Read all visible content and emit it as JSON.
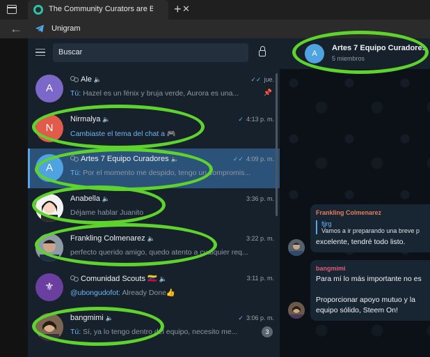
{
  "browser": {
    "tab_title": "The Community Curators are Bac",
    "tab_close": "✕",
    "new_tab": "+",
    "back": "←",
    "app_name": "Unigram"
  },
  "sidebar": {
    "search_placeholder": "Buscar"
  },
  "chats": [
    {
      "avatar_letter": "A",
      "avatar_color": "#7b68c9",
      "group": true,
      "name": "Ale",
      "muted": true,
      "time": "jue.",
      "ticks": "✓✓",
      "sender": "Tú:",
      "preview": "Hazel es un fénix y bruja verde, Aurora es una...",
      "pinned": true
    },
    {
      "avatar_letter": "N",
      "avatar_color": "#e25b4a",
      "group": false,
      "name": "Nirmalya",
      "muted": true,
      "time": "4:13 p. m.",
      "ticks": "✓",
      "preview_link": "Cambiaste el tema del chat a 🎮"
    },
    {
      "avatar_letter": "A",
      "avatar_color": "#4fa3e0",
      "group": true,
      "name": "Artes 7 Equipo Curadores",
      "muted": true,
      "time": "4:09 p. m.",
      "ticks": "✓✓",
      "sender": "Tú:",
      "preview": "Por el momento me despido, tengo un compromis...",
      "selected": true
    },
    {
      "avatar_letter": "",
      "avatar_color": "#e8e8e8",
      "group": false,
      "name": "Anabella",
      "muted": true,
      "time": "3:36 p. m.",
      "preview": "Déjame hablar Juanito"
    },
    {
      "avatar_letter": "",
      "avatar_color": "#9aa7b5",
      "group": false,
      "name": "Frankling Colmenarez",
      "muted": true,
      "time": "3:22 p. m.",
      "preview": "perfecto querido amigo, quedo atento a cualquier req..."
    },
    {
      "avatar_letter": "⚜",
      "avatar_color": "#6b3fa0",
      "group": true,
      "name": "Comunidad Scouts 🇻🇪",
      "muted": true,
      "time": "3:11 p. m.",
      "mention": "@ubongudofot:",
      "preview": "Already  Done👍"
    },
    {
      "avatar_letter": "",
      "avatar_color": "#8a6a4a",
      "group": false,
      "name": "bangmimi",
      "muted": true,
      "time": "3:06 p. m.",
      "ticks": "✓",
      "sender": "Tú:",
      "preview": "Sí, ya lo tengo dentro del equipo, necesito me...",
      "unread": "3"
    }
  ],
  "conversation": {
    "avatar_letter": "A",
    "title": "Artes 7 Equipo Curadores",
    "subtitle": "5 miembros",
    "messages": [
      {
        "sender": "Frankling Colmenarez",
        "sender_color": "#e87c5b",
        "reply_name": "fjjrg",
        "reply_text": "Vamos a ir preparando una breve p",
        "text": "excelente, tendré todo listo."
      },
      {
        "sender": "bangmimi",
        "sender_color": "#e25b7a",
        "lines": [
          "Para mí lo más importante no es",
          "",
          "Proporcionar apoyo mutuo y la",
          "equipo sólido, Steem On!"
        ]
      }
    ]
  },
  "colors": {
    "accent": "#5da4e4",
    "highlight": "#5fd32d",
    "panel": "#17212b",
    "selected": "#2b5278"
  }
}
